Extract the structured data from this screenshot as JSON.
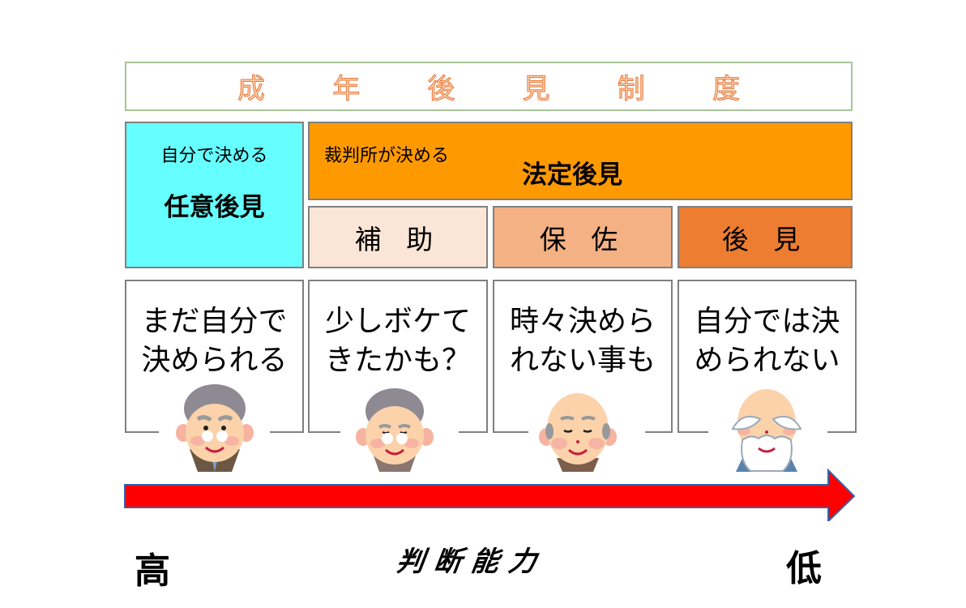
{
  "title": {
    "chars": [
      "成",
      "年",
      "後",
      "見",
      "制",
      "度"
    ],
    "text": "成年後見制度",
    "color": "#f4a06a"
  },
  "voluntary": {
    "sub_label": "自分で決める",
    "main_label": "任意後見",
    "color": "#66ffff"
  },
  "statutory": {
    "sub_label": "裁判所が決める",
    "main_label": "法定後見",
    "color": "#ff9900",
    "types": [
      {
        "label": "補 助",
        "color": "#fbe5d6"
      },
      {
        "label": "保 佐",
        "color": "#f4b183"
      },
      {
        "label": "後 見",
        "color": "#ed7d31"
      }
    ]
  },
  "stages": [
    {
      "line1": "まだ自分で",
      "line2": "決められる",
      "icon": "elderly-man-glasses-icon"
    },
    {
      "line1": "少しボケて",
      "line2": "きたかも？",
      "icon": "elderly-man-smiling-icon"
    },
    {
      "line1": "時々決めら",
      "line2": "れない事も",
      "icon": "elderly-man-bald-icon"
    },
    {
      "line1": "自分では決",
      "line2": "められない",
      "icon": "elderly-man-beard-icon"
    }
  ],
  "axis": {
    "label": "判断能力",
    "label_spaced": "判断能力",
    "high": "高",
    "low": "低",
    "arrow_color": "#ff0000"
  }
}
